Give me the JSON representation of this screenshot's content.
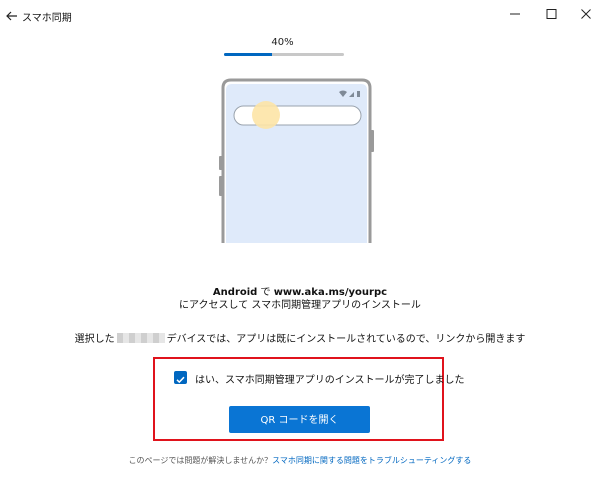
{
  "titlebar": {
    "app_title": "スマホ同期",
    "back_icon": "back-arrow-icon",
    "minimize_icon": "minimize-icon",
    "maximize_icon": "maximize-icon",
    "close_icon": "close-icon"
  },
  "progress": {
    "label": "40%",
    "value": 0.4,
    "fill_color": "#0067c0",
    "track_color": "#c8c8c8"
  },
  "illustration": {
    "device": "android-phone-outline-icon",
    "search_bar": "search-bar-placeholder",
    "tap_indicator": "tap-highlight-icon",
    "screen_color": "#dfeafa"
  },
  "instructions": {
    "line1_prefix": "Android",
    "line1_middle": " で ",
    "line1_url": "www.aka.ms/yourpc",
    "line2": "にアクセスして スマホ同期管理アプリのインストール"
  },
  "selected": {
    "prefix": "選択した",
    "suffix": "デバイスでは、アプリは既にインストールされているので、リンクから開きます"
  },
  "confirm": {
    "checkbox_checked": true,
    "checkbox_label": "はい、スマホ同期管理アプリのインストールが完了しました",
    "accent": "#0067c0"
  },
  "qr_button": {
    "label": "QR コードを開く",
    "color": "#0a75d4"
  },
  "footer": {
    "text": "このページでは問題が解決しませんか？",
    "link": "スマホ同期に関する問題をトラブルシューティングする"
  },
  "highlight_color": "#e0131c"
}
